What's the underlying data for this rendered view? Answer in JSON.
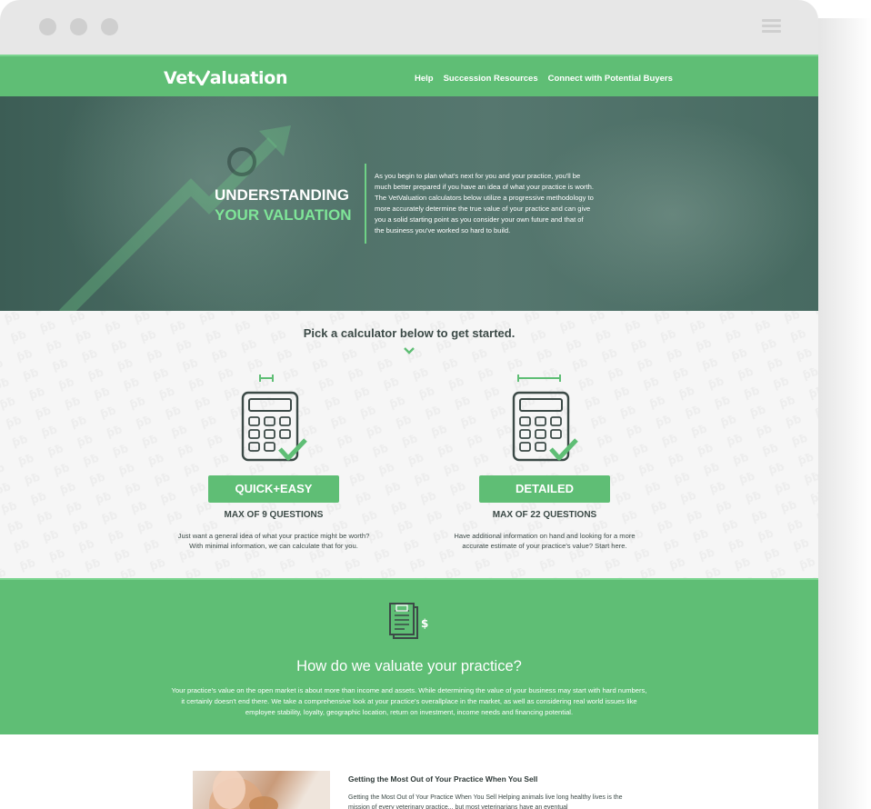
{
  "window": {
    "controls": [
      "close",
      "minimize",
      "maximize"
    ],
    "menu_icon": "hamburger-icon"
  },
  "nav": {
    "logo": {
      "before": "Vet",
      "after": "aluation"
    },
    "links": [
      "Help",
      "Succession Resources",
      "Connect with Potential Buyers"
    ]
  },
  "hero": {
    "title_line1": "UNDERSTANDING",
    "title_line2": "YOUR VALUATION",
    "text": "As you begin to plan what's next for you and your practice, you'll be much better prepared if you have an idea of what your practice is worth. The VetValuation calculators below utilize a progressive methodology to more accurately determine the true value of your practice and can give you a solid starting point as you consider your own future and that of the business you've worked so hard to build."
  },
  "pick": {
    "title": "Pick a calculator below to get started.",
    "calculators": [
      {
        "button": "QUICK+EASY",
        "subtitle": "MAX OF 9 QUESTIONS",
        "desc_line1": "Just want a general idea of what your practice might be worth?",
        "desc_line2": "With minimal information, we can calculate that for you."
      },
      {
        "button": "DETAILED",
        "subtitle": "MAX OF 22 QUESTIONS",
        "desc_line1": "Have additional information on hand and looking for a more",
        "desc_line2": "accurate estimate of your practice's value? Start here."
      }
    ]
  },
  "valuation": {
    "title": "How do we valuate your practice?",
    "text": "Your practice's value on the open market is about more than income and assets. While determining the value of your business may start with hard numbers, it certainly doesn't end there. We take a comprehensive look at your practice's overallplace in the market, as well as considering real world issues like employee stability, loyalty, geographic location, return on investment, income needs and financing potential."
  },
  "article": {
    "title": "Getting the Most Out of Your Practice When You Sell",
    "text": "Getting the Most Out of Your Practice When You Sell Helping animals live long healthy lives is the mission of every veterinary practice... but most veterinarians have an eventual"
  },
  "colors": {
    "brand_green": "#5fbe75",
    "accent_green": "#7fe598",
    "hero_dark": "#4d6f66",
    "text_dark": "#3c4a47"
  }
}
